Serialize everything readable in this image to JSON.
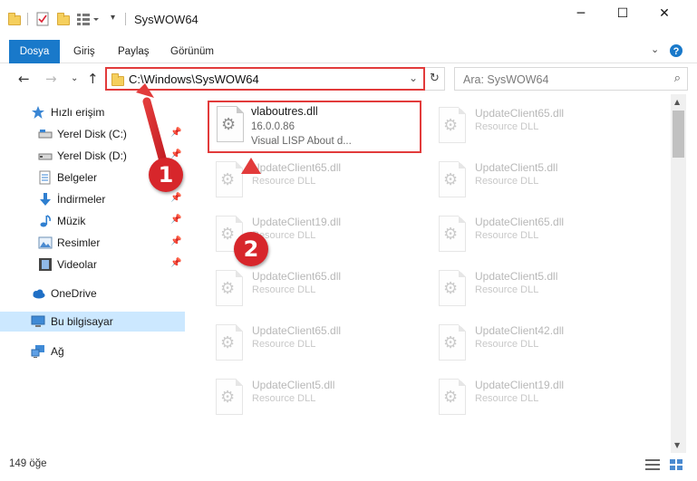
{
  "window": {
    "title": "SysWOW64",
    "minimize_icon": "minimize-icon",
    "maximize_icon": "maximize-icon",
    "close_icon": "close-icon"
  },
  "ribbon": {
    "tabs": [
      "Dosya",
      "Giriş",
      "Paylaş",
      "Görünüm"
    ]
  },
  "address": {
    "path": "C:\\Windows\\SysWOW64",
    "search_placeholder": "Ara: SysWOW64"
  },
  "nav": {
    "items": [
      {
        "label": "Hızlı erişim",
        "icon": "star-icon"
      },
      {
        "label": "Yerel Disk (C:)",
        "icon": "drive-icon",
        "pinned": true
      },
      {
        "label": "Yerel Disk (D:)",
        "icon": "drive-icon",
        "pinned": true
      },
      {
        "label": "Belgeler",
        "icon": "documents-icon",
        "pinned": true
      },
      {
        "label": "İndirmeler",
        "icon": "download-icon",
        "pinned": true
      },
      {
        "label": "Müzik",
        "icon": "music-icon",
        "pinned": true
      },
      {
        "label": "Resimler",
        "icon": "pictures-icon",
        "pinned": true
      },
      {
        "label": "Videolar",
        "icon": "video-icon",
        "pinned": true
      },
      {
        "label": "OneDrive",
        "icon": "cloud-icon"
      },
      {
        "label": "Bu bilgisayar",
        "icon": "computer-icon",
        "selected": true
      },
      {
        "label": "Ağ",
        "icon": "network-icon"
      }
    ]
  },
  "highlighted_file": {
    "name": "vlaboutres.dll",
    "version": "16.0.0.86",
    "description": "Visual LISP About d..."
  },
  "files": [
    {
      "name": "UpdateClient65.dll",
      "type": "Resource DLL"
    },
    {
      "name": "UpdateClient65.dll",
      "type": "Resource DLL"
    },
    {
      "name": "UpdateClient5.dll",
      "type": "Resource DLL"
    },
    {
      "name": "UpdateClient19.dll",
      "type": "Resource DLL"
    },
    {
      "name": "UpdateClient65.dll",
      "type": "Resource DLL"
    },
    {
      "name": "UpdateClient65.dll",
      "type": "Resource DLL"
    },
    {
      "name": "UpdateClient5.dll",
      "type": "Resource DLL"
    },
    {
      "name": "UpdateClient65.dll",
      "type": "Resource DLL"
    },
    {
      "name": "UpdateClient42.dll",
      "type": "Resource DLL"
    },
    {
      "name": "UpdateClient5.dll",
      "type": "Resource DLL"
    },
    {
      "name": "UpdateClient19.dll",
      "type": "Resource DLL"
    }
  ],
  "status": {
    "count": "149 öğe"
  },
  "markers": [
    "1",
    "2"
  ],
  "colors": {
    "accent": "#1979ca",
    "highlight_border": "#e23b3b",
    "marker": "#d7262b",
    "selection": "#cce8ff"
  }
}
